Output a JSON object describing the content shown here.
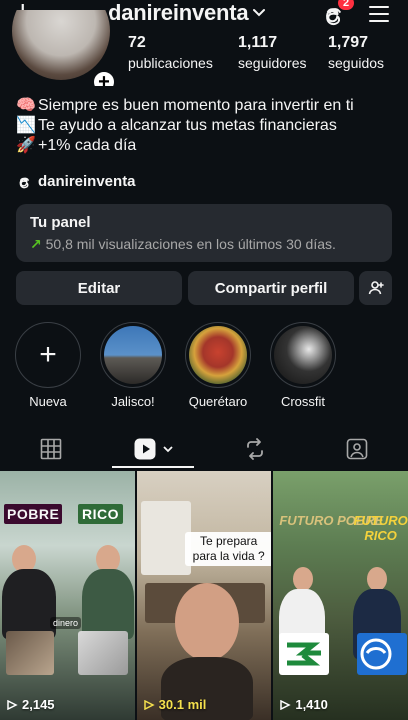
{
  "header": {
    "username": "danireinventa",
    "notification_count": "2",
    "icons": {
      "new_post": "plus-icon",
      "account_switcher": "chevron-down-icon",
      "threads": "threads-icon",
      "menu": "hamburger-menu-icon"
    }
  },
  "profile": {
    "stats": [
      {
        "value": "72",
        "label": "publicaciones"
      },
      {
        "value": "1,117",
        "label": "seguidores"
      },
      {
        "value": "1,797",
        "label": "seguidos"
      }
    ],
    "bio": [
      {
        "emoji": "🧠",
        "text": "Siempre es buen momento para invertir en ti"
      },
      {
        "emoji": "📉",
        "text": "Te ayudo a alcanzar tus metas financieras"
      },
      {
        "emoji": "🚀",
        "text": "+1% cada día"
      }
    ],
    "threads_handle": "danireinventa"
  },
  "panel": {
    "title": "Tu panel",
    "subtitle": "50,8 mil visualizaciones en los últimos 30 días.",
    "arrow": "↗"
  },
  "actions": {
    "edit_label": "Editar",
    "share_label": "Compartir perfil"
  },
  "highlights": [
    {
      "label": "Nueva"
    },
    {
      "label": "Jalisco!"
    },
    {
      "label": "Querétaro"
    },
    {
      "label": "Crossfit"
    }
  ],
  "tabs": [
    "grid-icon",
    "reels-icon",
    "reposts-icon",
    "tagged-icon"
  ],
  "posts": [
    {
      "labels": [
        "POBRE",
        "RICO",
        "dinero"
      ],
      "views": "2,145"
    },
    {
      "labels": [
        "Te prepara para la vida ?"
      ],
      "views": "30.1 mil"
    },
    {
      "labels": [
        "FUTURO POBRE",
        "FUTURO RICO"
      ],
      "views": "1,410"
    }
  ],
  "colors": {
    "background": "#0c1014",
    "card": "#262a30",
    "accent_green": "#58c322",
    "badge_red": "#ff3040",
    "views_highlight": "#f4e04d"
  }
}
